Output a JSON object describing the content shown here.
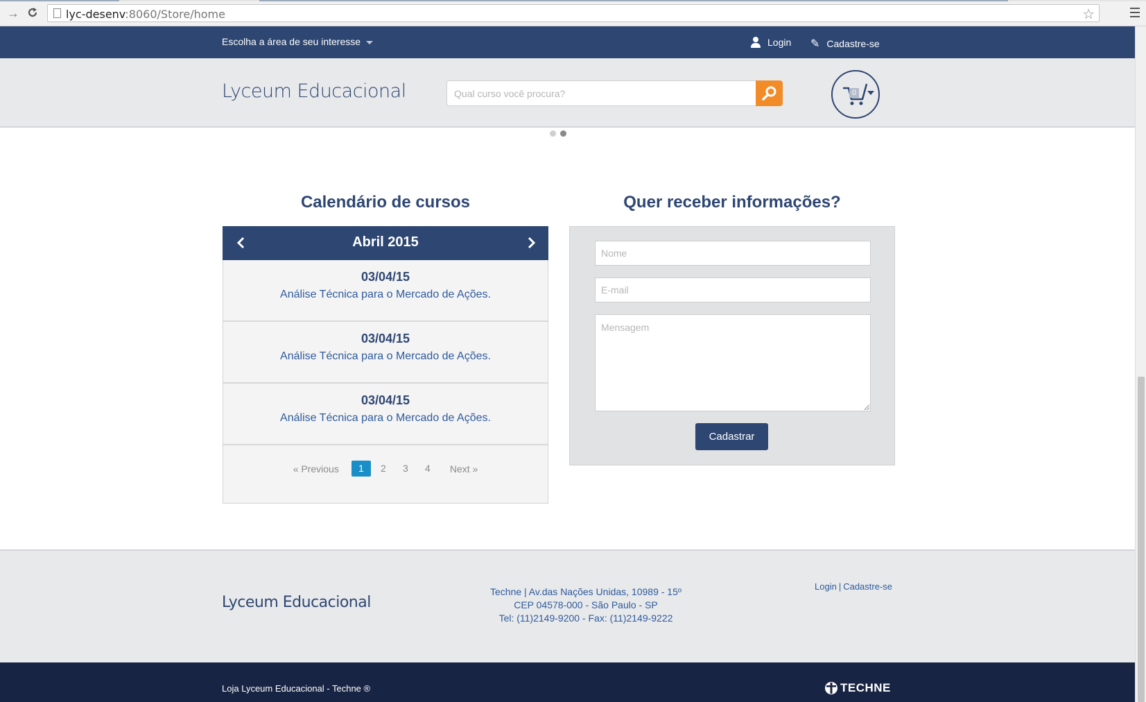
{
  "browser": {
    "url_host": "lyc-desenv",
    "url_path": ":8060/Store/home"
  },
  "topbar": {
    "area_select": "Escolha a área de seu interesse",
    "login": "Login",
    "register": "Cadastre-se"
  },
  "header": {
    "brand": "Lyceum Educacional",
    "search_placeholder": "Qual curso você procura?",
    "cart_count": "0"
  },
  "slider": {
    "dots": 2,
    "active_index": 1
  },
  "calendar": {
    "title": "Calendário de cursos",
    "month": "Abril 2015",
    "items": [
      {
        "date": "03/04/15",
        "course": "Análise Técnica para o Mercado de Ações."
      },
      {
        "date": "03/04/15",
        "course": "Análise Técnica para o Mercado de Ações."
      },
      {
        "date": "03/04/15",
        "course": "Análise Técnica para o Mercado de Ações."
      }
    ],
    "pagination": {
      "previous": "« Previous",
      "pages": [
        "1",
        "2",
        "3",
        "4"
      ],
      "active_page": "1",
      "next": "Next »"
    }
  },
  "contact": {
    "title": "Quer receber informações?",
    "name_placeholder": "Nome",
    "email_placeholder": "E-mail",
    "message_placeholder": "Mensagem",
    "submit": "Cadastrar"
  },
  "footer": {
    "brand": "Lyceum Educacional",
    "address_line1": "Techne | Av.das Nações Unidas, 10989 - 15º",
    "address_line2": "CEP 04578-000 - São Paulo - SP",
    "address_line3": "Tel: (11)2149-9200 - Fax: (11)2149-9222",
    "login": "Login",
    "separator": "|",
    "register": "Cadastre-se",
    "copyright": "Loja Lyceum Educacional - Techne ®",
    "techne_logo": "TECHNE"
  },
  "colors": {
    "primary": "#2e4672",
    "accent": "#f28c28",
    "link": "#2e5a9c",
    "active_page": "#1a8fc7",
    "footer_dark": "#182444"
  },
  "icons": {
    "back": "arrow-right-icon",
    "reload": "reload-icon",
    "page": "page-icon",
    "star": "star-icon",
    "menu": "hamburger-menu-icon",
    "user": "user-icon",
    "pencil": "pencil-icon",
    "search": "magnifier-icon",
    "cart": "shopping-cart-icon",
    "cal_prev": "chevron-left-icon",
    "cal_next": "chevron-right-icon"
  }
}
